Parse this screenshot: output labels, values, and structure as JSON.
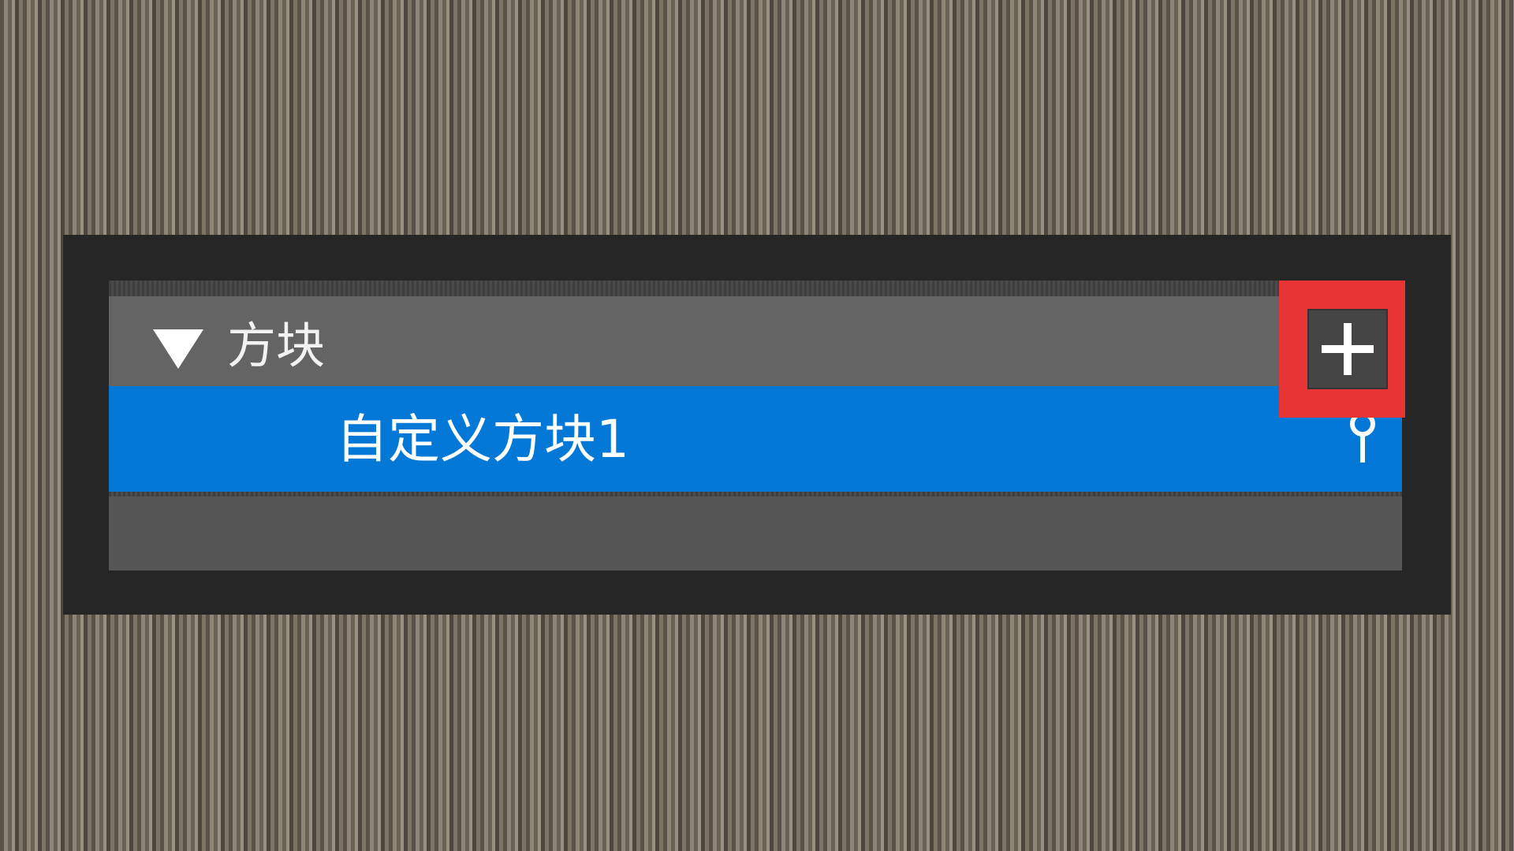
{
  "panel": {
    "category": {
      "label": "方块",
      "expanded": true,
      "expand_icon": "triangle-down-icon"
    },
    "items": [
      {
        "label": "自定义方块1",
        "selected": true,
        "icon": "pin-icon"
      }
    ],
    "add_button": {
      "icon": "plus-icon",
      "highlighted": true
    }
  },
  "colors": {
    "selection": "#0478d6",
    "highlight": "#e83434",
    "panel_frame": "#262626",
    "category_row": "#646464"
  }
}
